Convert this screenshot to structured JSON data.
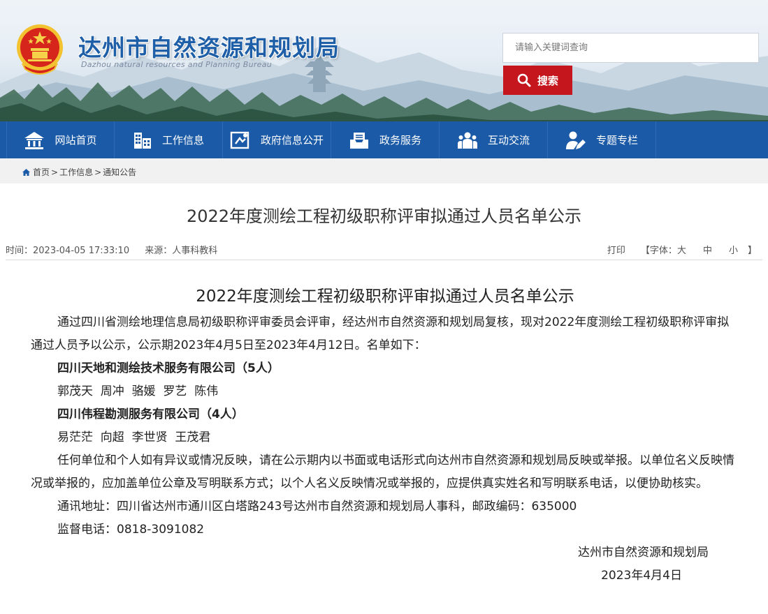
{
  "header": {
    "site_title": "达州市自然资源和规划局",
    "site_subtitle": "Dazhou natural resources and Planning Bureau",
    "search_placeholder": "请输入关键词查询",
    "search_button": "搜索"
  },
  "nav": {
    "items": [
      {
        "label": "网站首页",
        "icon": "home-icon"
      },
      {
        "label": "工作信息",
        "icon": "building-icon"
      },
      {
        "label": "政府信息公开",
        "icon": "document-icon"
      },
      {
        "label": "政务服务",
        "icon": "inbox-icon"
      },
      {
        "label": "互动交流",
        "icon": "people-icon"
      },
      {
        "label": "专题专栏",
        "icon": "user-edit-icon"
      }
    ]
  },
  "breadcrumb": {
    "home": "首页",
    "sep1": ">",
    "level1": "工作信息",
    "sep2": ">",
    "level2": "通知公告"
  },
  "article": {
    "page_title": "2022年度测绘工程初级职称评审拟通过人员名单公示",
    "time_label": "时间：",
    "time": "2023-04-05 17:33:10",
    "source_label": "来源：",
    "source": "人事科教科",
    "print": "打印",
    "font_open": "【字体：",
    "font_large": "大",
    "font_medium": "中",
    "font_small": "小",
    "font_close": "】",
    "heading": "2022年度测绘工程初级职称评审拟通过人员名单公示",
    "intro": "通过四川省测绘地理信息局初级职称评审委员会评审，经达州市自然资源和规划局复核，现对2022年度测绘工程初级职称评审拟通过人员予以公示，公示期2023年4月5日至2023年4月12日。名单如下：",
    "company1": "四川天地和测绘技术服务有限公司（5人）",
    "names1": "郭茂天  周冲  骆媛  罗艺  陈伟",
    "company2": "四川伟程勘测服务有限公司（4人）",
    "names2": "易茫茫  向超  李世贤  王茂君",
    "notice": "任何单位和个人如有异议或情况反映，请在公示期内以书面或电话形式向达州市自然资源和规划局反映或举报。以单位名义反映情况或举报的，应加盖单位公章及写明联系方式；以个人名义反映情况或举报的，应提供真实姓名和写明联系电话，以便协助核实。",
    "address": "通讯地址：四川省达州市通川区白塔路243号达州市自然资源和规划局人事科，邮政编码：635000",
    "phone": "监督电话：0818-3091082",
    "signature": "达州市自然资源和规划局",
    "date": "2023年4月4日"
  },
  "colors": {
    "nav_bg": "#1b5aa7",
    "title_blue": "#1f5fa8",
    "search_red": "#c4161c"
  }
}
